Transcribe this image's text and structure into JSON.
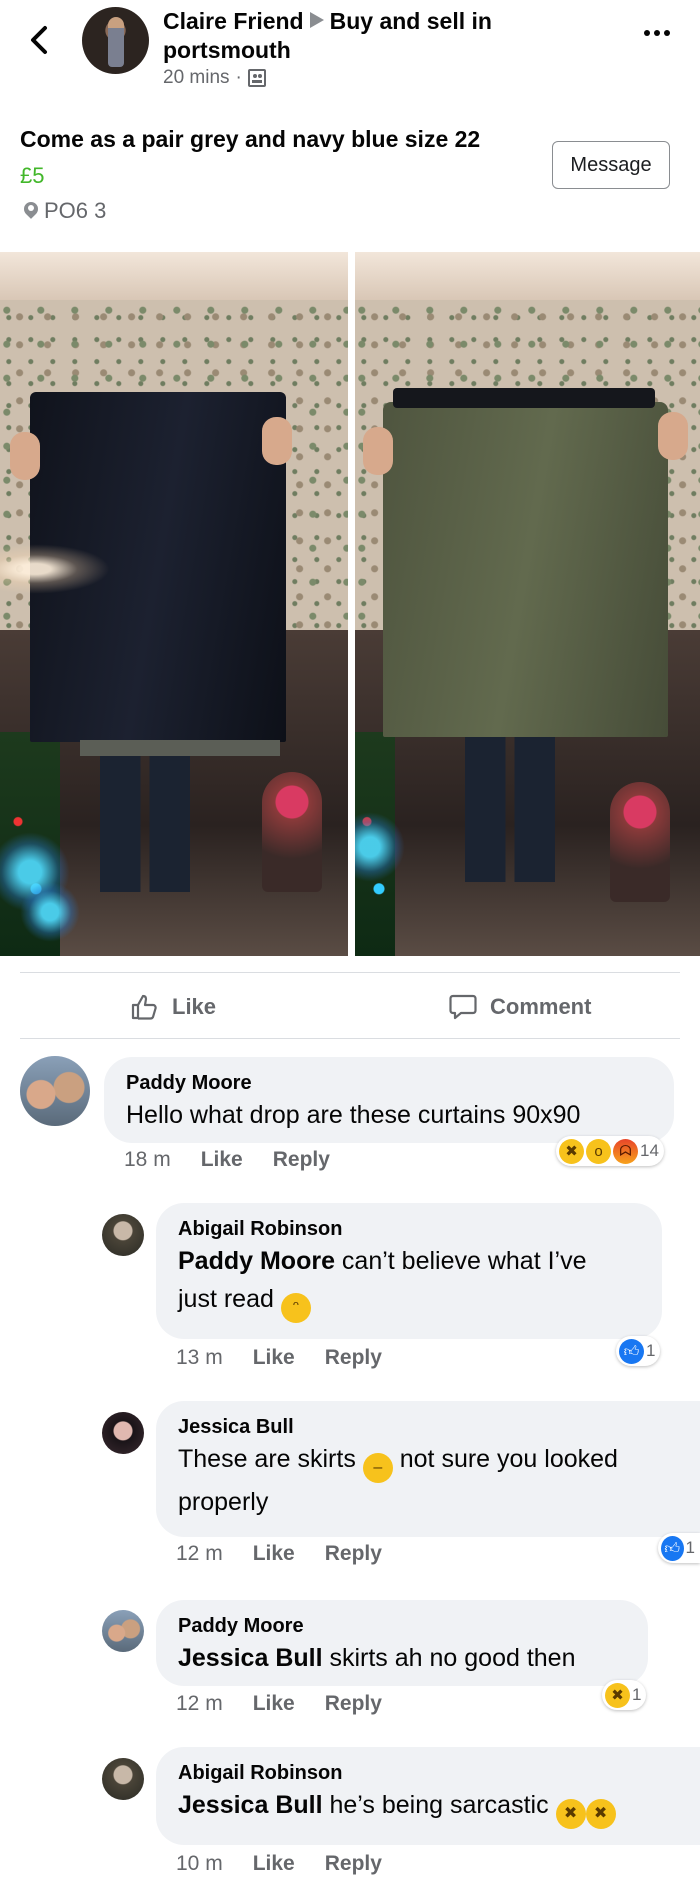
{
  "header": {
    "poster_name": "Claire Friend",
    "group_name": "Buy and sell in portsmouth",
    "time": "20 mins",
    "separator": "·"
  },
  "listing": {
    "title": "Come as a pair grey and navy blue size 22",
    "price": "£5",
    "location": "PO6 3",
    "message_label": "Message"
  },
  "actions": {
    "like_label": "Like",
    "comment_label": "Comment"
  },
  "comments": [
    {
      "author": "Paddy Moore",
      "mention": "",
      "text": "Hello what drop are these curtains 90x90",
      "time": "18 m",
      "like": "Like",
      "reply": "Reply",
      "reaction_icons": [
        "laugh-emoji",
        "wow-emoji",
        "angry-emoji"
      ],
      "reaction_count": "14"
    },
    {
      "author": "Abigail Robinson",
      "mention": "Paddy Moore",
      "text_line1": " can’t believe what I’ve",
      "text_line2": "just read",
      "inline_icon": "weary-emoji",
      "time": "13 m",
      "like": "Like",
      "reply": "Reply",
      "reaction_icons": [
        "like-emoji"
      ],
      "reaction_count": "1"
    },
    {
      "author": "Jessica Bull",
      "mention": "",
      "text_line1a": "These are skirts",
      "text_line1b": "not sure you looked",
      "text_line2": "properly",
      "inline_icon": "expressionless-emoji",
      "time": "12 m",
      "like": "Like",
      "reply": "Reply",
      "reaction_icons": [
        "like-emoji"
      ],
      "reaction_count": "1"
    },
    {
      "author": "Paddy Moore",
      "mention": "Jessica Bull",
      "text": " skirts ah no good then",
      "time": "12 m",
      "like": "Like",
      "reply": "Reply",
      "reaction_icons": [
        "laugh-emoji"
      ],
      "reaction_count": "1"
    },
    {
      "author": "Abigail Robinson",
      "mention": "Jessica Bull",
      "text": " he’s being sarcastic",
      "inline_icons": [
        "tears-of-joy-emoji",
        "rofl-emoji"
      ],
      "time": "10 m",
      "like": "Like",
      "reply": "Reply"
    }
  ],
  "colors": {
    "price_green": "#42b72a",
    "bubble_bg": "#f0f2f5",
    "secondary_text": "#65676b",
    "like_blue": "#1877f2"
  }
}
